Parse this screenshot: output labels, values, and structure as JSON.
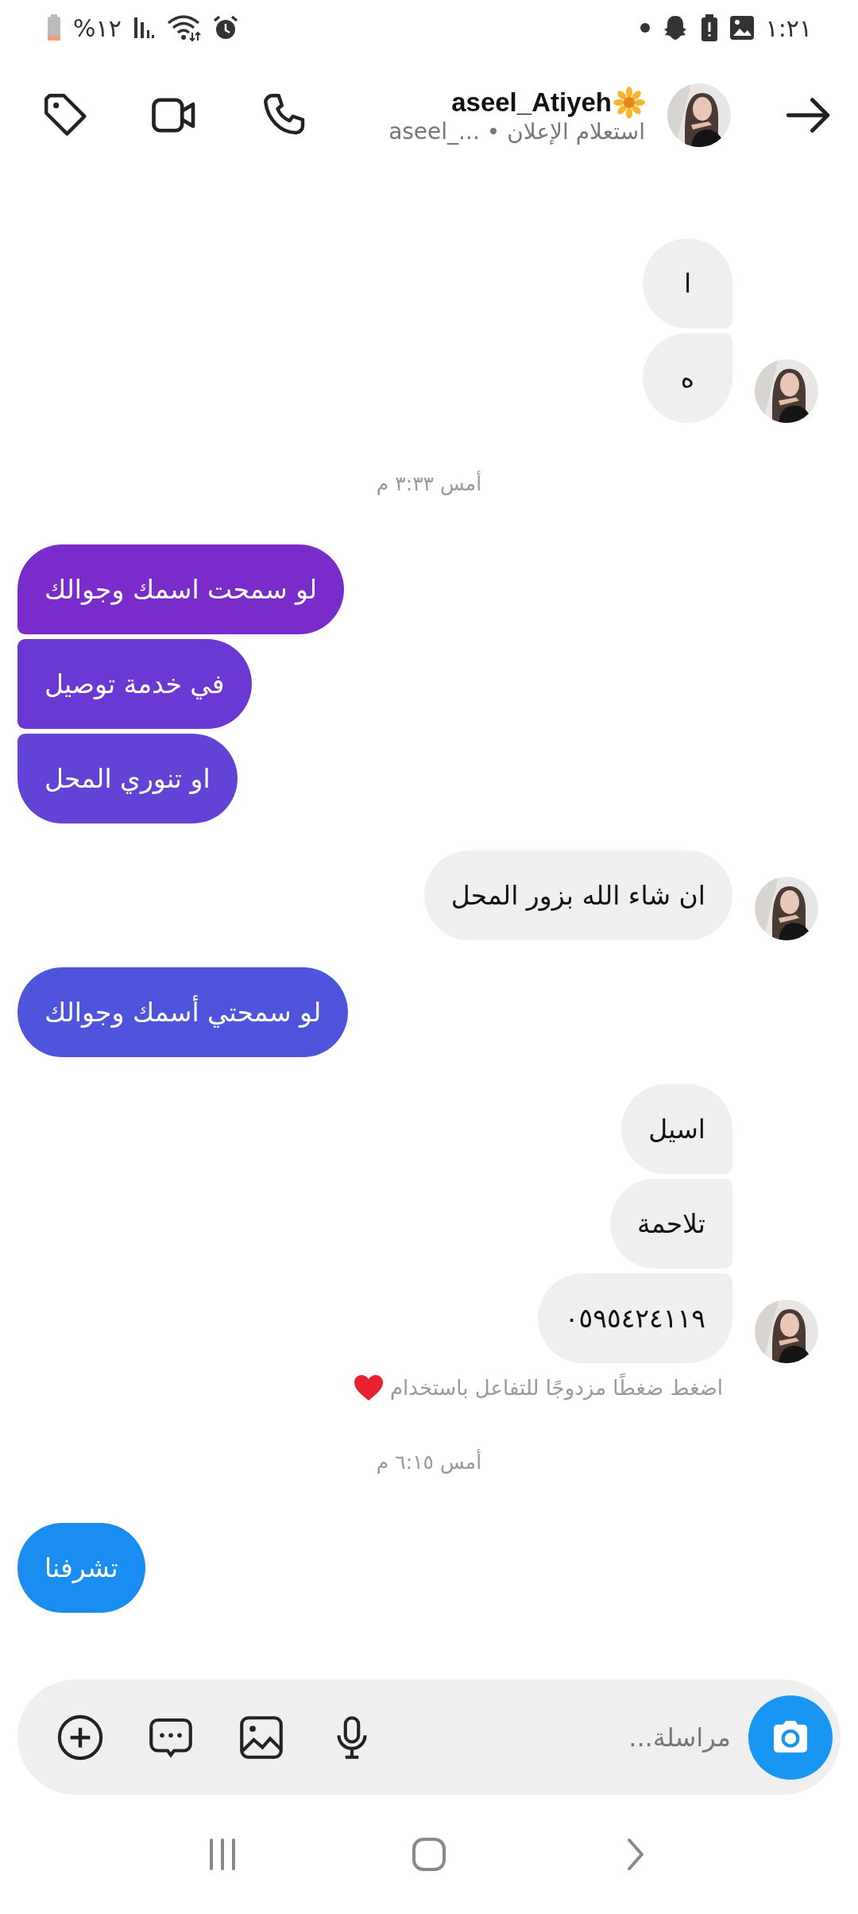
{
  "status_bar": {
    "battery": "%١٢",
    "time": "١:٢١"
  },
  "header": {
    "title": "aseel_Atiyeh",
    "subtitle": "aseel_... • استعلام الإعلان"
  },
  "messages": [
    {
      "kind": "received",
      "text": "ا",
      "avatar": false
    },
    {
      "kind": "received",
      "text": "ه",
      "avatar": true
    },
    {
      "kind": "timestamp",
      "text": "أمس ٣:٣٣ م"
    },
    {
      "kind": "sent",
      "text": "لو سمحت اسمك وجوالك",
      "color": "#7a2ccb"
    },
    {
      "kind": "sent",
      "text": "في خدمة توصيل",
      "color": "#6c38d4"
    },
    {
      "kind": "sent",
      "text": "او تنوري المحل",
      "color": "#6342d6"
    },
    {
      "kind": "received",
      "text": "ان شاء الله بزور المحل",
      "avatar": true
    },
    {
      "kind": "sent",
      "text": "لو سمحتي أسمك وجوالك",
      "color": "#4f54dc"
    },
    {
      "kind": "received",
      "text": "اسيل",
      "avatar": false
    },
    {
      "kind": "received",
      "text": "تلاحمة",
      "avatar": false
    },
    {
      "kind": "received",
      "text": "٠٥٩٥٤٢٤١١٩",
      "avatar": true
    },
    {
      "kind": "hint",
      "text": "اضغط ضغطًا مزدوجًا للتفاعل باستخدام"
    },
    {
      "kind": "timestamp",
      "text": "أمس ٦:١٥ م"
    },
    {
      "kind": "sent",
      "text": "تشرفنا",
      "color": "#1a8ef0"
    }
  ],
  "composer": {
    "placeholder": "مراسلة..."
  }
}
